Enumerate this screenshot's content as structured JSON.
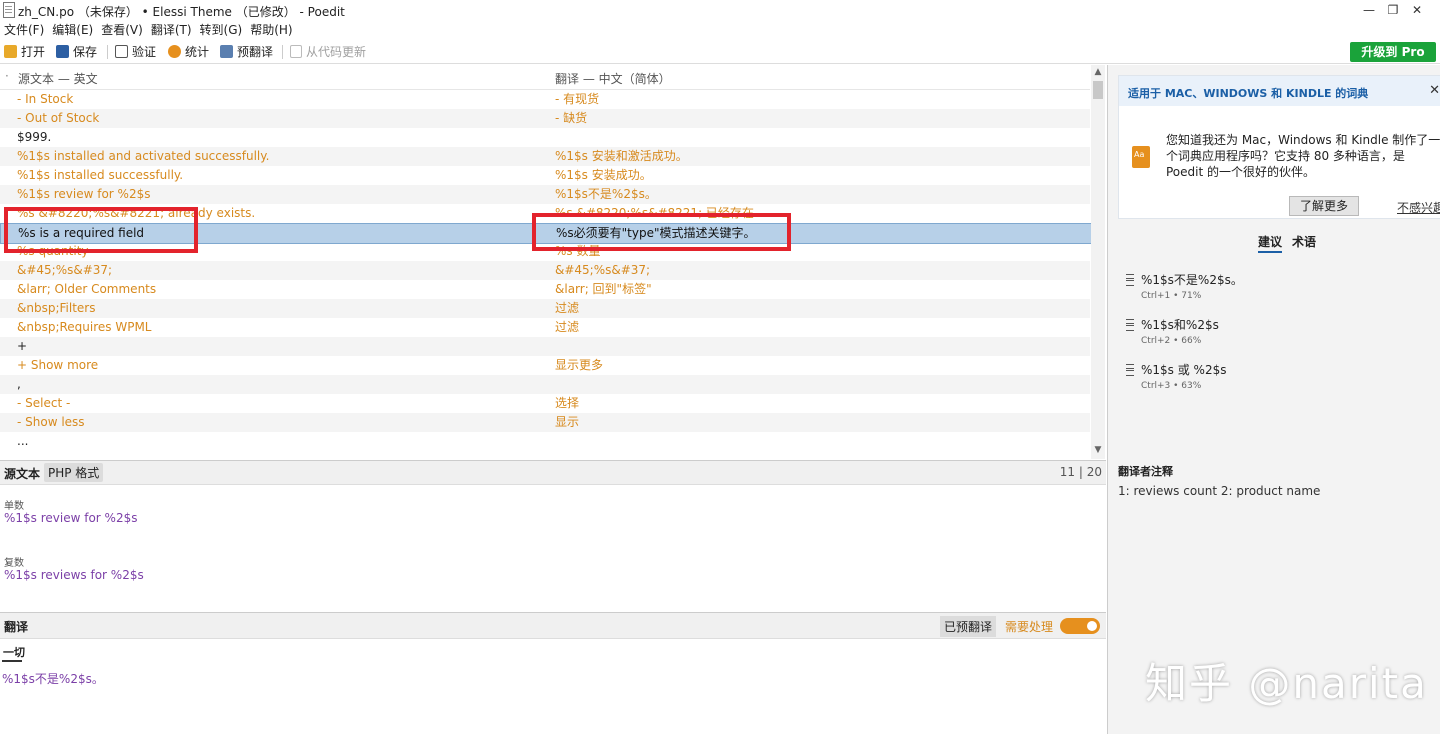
{
  "window": {
    "title": "zh_CN.po （未保存） • Elessi Theme （已修改） - Poedit",
    "controls": [
      "—",
      "❐",
      "✕"
    ]
  },
  "menu": [
    "文件(F)",
    "编辑(E)",
    "查看(V)",
    "翻译(T)",
    "转到(G)",
    "帮助(H)"
  ],
  "toolbar": {
    "open": "打开",
    "save": "保存",
    "validate": "验证",
    "stats": "统计",
    "pretranslate": "预翻译",
    "update": "从代码更新",
    "upgrade": "升级到 Pro"
  },
  "list": {
    "col_source": "源文本 — 英文",
    "col_translation": "翻译 — 中文（简体）",
    "rows": [
      {
        "src": "- In Stock",
        "trn": "- 有现货",
        "style": "orange"
      },
      {
        "src": "- Out of Stock",
        "trn": "- 缺货",
        "style": "orange"
      },
      {
        "src": "$999.",
        "trn": "",
        "style": "plain"
      },
      {
        "src": "%1$s installed and activated successfully.",
        "trn": "%1$s 安装和激活成功。",
        "style": "orange"
      },
      {
        "src": "%1$s installed successfully.",
        "trn": "%1$s 安装成功。",
        "style": "orange"
      },
      {
        "src": "%1$s review for %2$s",
        "trn": "%1$s不是%2$s。",
        "style": "orange"
      },
      {
        "src": "%s &#8220;%s&#8221; already exists.",
        "trn": "%s &#8220;%s&#8221; 已经存在",
        "style": "orange"
      },
      {
        "src": "%s is a required field",
        "trn": "%s必须要有\"type\"模式描述关键字。",
        "style": "selected"
      },
      {
        "src": "%s quantity",
        "trn": "%s 数量",
        "style": "orange"
      },
      {
        "src": "&#45;%s&#37;",
        "trn": "&#45;%s&#37;",
        "style": "orange"
      },
      {
        "src": "&larr; Older Comments",
        "trn": "&larr; 回到\"标签\"",
        "style": "orange"
      },
      {
        "src": "&nbsp;Filters",
        "trn": "过滤",
        "style": "orange"
      },
      {
        "src": "&nbsp;Requires WPML",
        "trn": "过滤",
        "style": "orange"
      },
      {
        "src": "+",
        "trn": "",
        "style": "plain"
      },
      {
        "src": "+ Show more",
        "trn": "显示更多",
        "style": "orange"
      },
      {
        "src": ",",
        "trn": "",
        "style": "plain"
      },
      {
        "src": "- Select -",
        "trn": "选择",
        "style": "orange"
      },
      {
        "src": "- Show less",
        "trn": "显示",
        "style": "orange"
      },
      {
        "src": "...",
        "trn": "",
        "style": "plain"
      }
    ]
  },
  "source_panel": {
    "title": "源文本",
    "tag": "PHP 格式",
    "counter": "11 | 20",
    "singular_label": "单数",
    "singular_text": "%1$s review for %2$s",
    "plural_label": "复数",
    "plural_text": "%1$s reviews for %2$s"
  },
  "translation_panel": {
    "title": "翻译",
    "pretranslated": "已预翻译",
    "needs_work": "需要处理",
    "tab_all": "一切",
    "text": "%1$s不是%2$s。"
  },
  "sidebar": {
    "notice_title": "适用于 MAC、WINDOWS 和 KINDLE 的词典",
    "notice_body": "您知道我还为 Mac，Windows 和 Kindle 制作了一个词典应用程序吗？它支持 80 多种语言，是 Poedit 的一个很好的伙伴。",
    "learn_more": "了解更多",
    "not_interested": "不感兴趣",
    "tabs": [
      "建议",
      "术语"
    ],
    "suggestions": [
      {
        "text": "%1$s不是%2$s。",
        "meta": "Ctrl+1 • 71%"
      },
      {
        "text": "%1$s和%2$s",
        "meta": "Ctrl+2 • 66%"
      },
      {
        "text": "%1$s 或 %2$s",
        "meta": "Ctrl+3 • 63%"
      }
    ],
    "notes_title": "翻译者注释",
    "notes_text": "1: reviews count 2: product name"
  },
  "watermark": "知乎 @narita",
  "colors": {
    "accent": "#1b5fa6",
    "orange": "#d78a1e",
    "upgrade": "#1aa33a",
    "highlight": "#e3232c",
    "selected_row": "#b7d0e8"
  }
}
